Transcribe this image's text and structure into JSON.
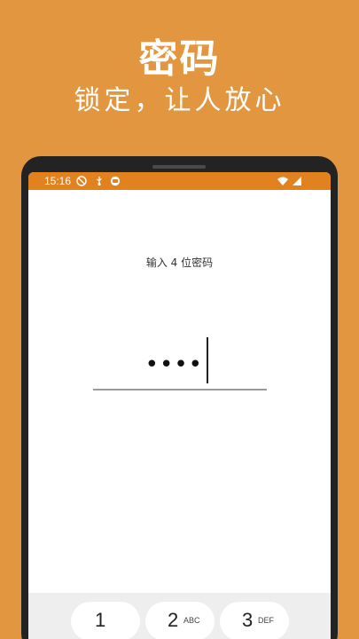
{
  "promo": {
    "title": "密码",
    "subtitle": "锁定，让人放心"
  },
  "status_bar": {
    "time": "15:16",
    "icons": [
      "do-not-disturb-icon",
      "usb-icon",
      "app-notification-icon",
      "wifi-icon",
      "signal-icon"
    ]
  },
  "lock_screen": {
    "prompt": "输入 4 位密码",
    "pin_masked": "••••"
  },
  "keypad": {
    "keys": [
      {
        "number": "1",
        "letters": ""
      },
      {
        "number": "2",
        "letters": "ABC"
      },
      {
        "number": "3",
        "letters": "DEF"
      }
    ]
  },
  "colors": {
    "background": "#E2963F",
    "status_bar": "#E2821F",
    "device_frame": "#232323"
  }
}
